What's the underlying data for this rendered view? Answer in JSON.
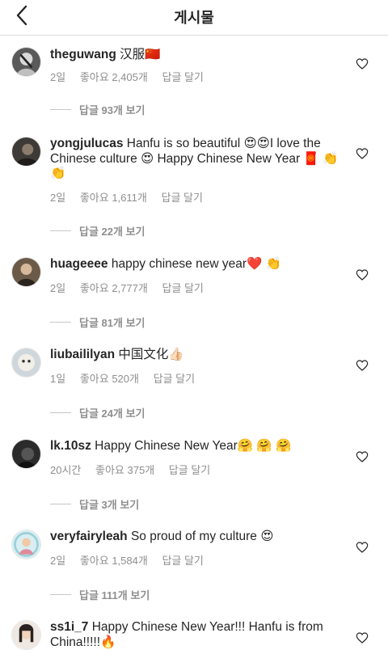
{
  "header": {
    "title": "게시물"
  },
  "labels": {
    "like_prefix": "좋아요",
    "like_suffix": "개",
    "reply": "답글 달기"
  },
  "comments": [
    {
      "username": "theguwang",
      "text": "汉服",
      "trailing_emoji": "🇨🇳",
      "time": "2일",
      "likes": "좋아요 2,405개",
      "reply": "답글 달기",
      "view_replies": "답글 93개 보기"
    },
    {
      "username": "yongjulucas",
      "text": "Hanfu is so beautiful 😍😍I love the Chinese culture 😍 Happy Chinese New Year 🧧 👏👏",
      "time": "2일",
      "likes": "좋아요 1,611개",
      "reply": "답글 달기",
      "view_replies": "답글 22개 보기"
    },
    {
      "username": "huageeee",
      "text": "happy chinese new year❤️ 👏",
      "time": "2일",
      "likes": "좋아요 2,777개",
      "reply": "답글 달기",
      "view_replies": "답글 81개 보기"
    },
    {
      "username": "liubaililyan",
      "text": "中国文化👍🏻",
      "time": "1일",
      "likes": "좋아요 520개",
      "reply": "답글 달기",
      "view_replies": "답글 24개 보기"
    },
    {
      "username": "lk.10sz",
      "text": "Happy Chinese New Year🤗 🤗 🤗",
      "time": "20시간",
      "likes": "좋아요 375개",
      "reply": "답글 달기",
      "view_replies": "답글 3개 보기"
    },
    {
      "username": "veryfairyleah",
      "text": "So proud of my culture 😍",
      "time": "2일",
      "likes": "좋아요 1,584개",
      "reply": "답글 달기",
      "view_replies": "답글 111개 보기"
    },
    {
      "username": "ss1i_7",
      "text": "Happy Chinese New Year!!! Hanfu is from China!!!!!🔥"
    }
  ]
}
